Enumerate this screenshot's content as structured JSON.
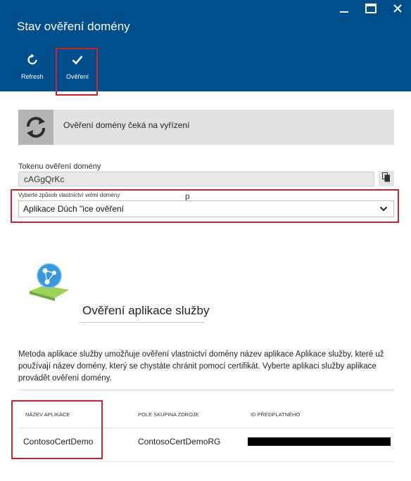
{
  "window": {
    "title": "Stav ověření domény"
  },
  "commands": {
    "refresh_label": "Refresh",
    "verify_label": "Ověření"
  },
  "status": {
    "text": "Ověření domény čeká na vyřízení"
  },
  "token": {
    "label": "Tokenu ověření domény",
    "value": "cAGgQrKc"
  },
  "method": {
    "label": "Vyberte způsob vlastnictví velmi domény",
    "stray_char": "p",
    "selected": "Aplikace Dúch \"ice ověření"
  },
  "section": {
    "title": "Ověření aplikace služby",
    "description": "Metoda aplikace služby umožňuje ověření vlastnictví domény název aplikace Aplikace služby, které už používají název domény, který se chystáte chránit pomocí certifikát. Vyberte aplikaci služby aplikace provádět ověření domény."
  },
  "table": {
    "columns": [
      "NÁZEV APLIKACE",
      "POLE SKUPINA ZDROJE",
      "ID PŘEDPLATNÉHO"
    ],
    "rows": [
      {
        "app_name": "ContosoCertDemo",
        "resource_group": "ContosoCertDemoRG"
      }
    ]
  },
  "colors": {
    "header_bg": "#004e8c",
    "highlight_red": "#c9242d",
    "status_bg": "#e2e2e2"
  },
  "icons": [
    "refresh-icon",
    "checkmark-icon",
    "minimize-icon",
    "maximize-icon",
    "copy-icon",
    "chevron-down-icon",
    "sync-icon",
    "app-service-icon"
  ]
}
